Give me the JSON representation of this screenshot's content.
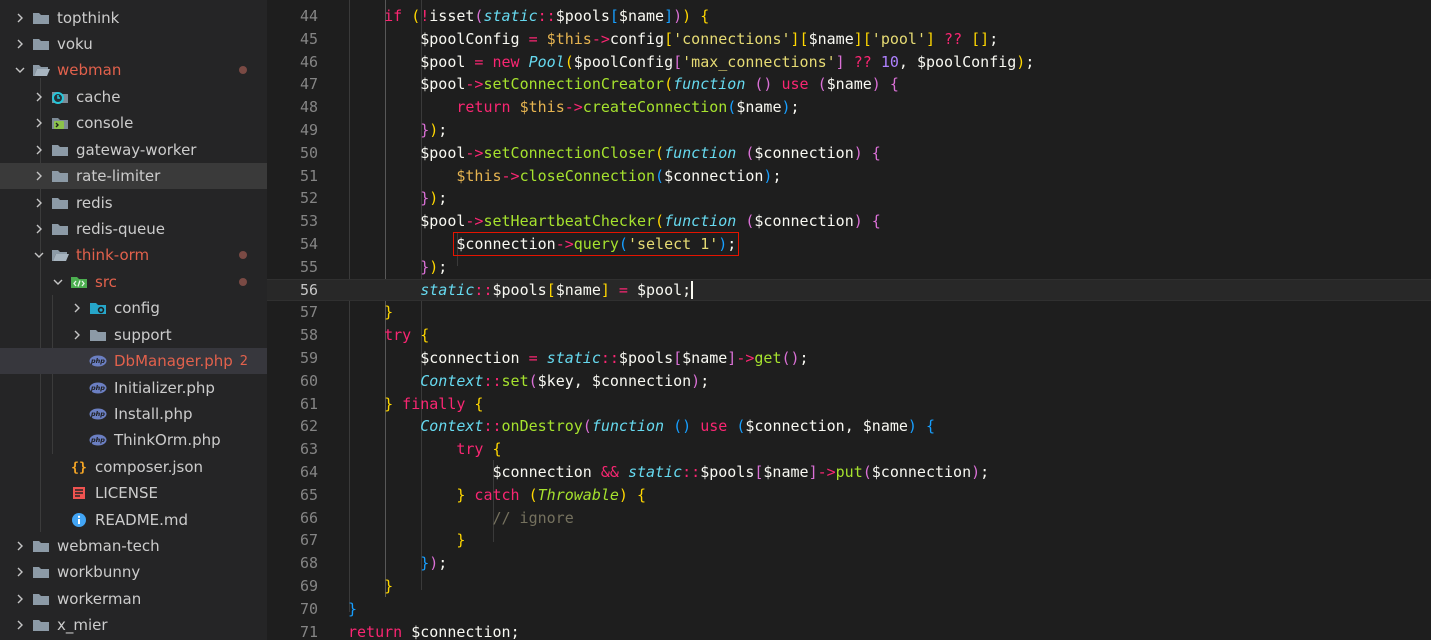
{
  "explorer": {
    "items": [
      {
        "label": "topthink",
        "icon": "folder-icon",
        "kind": "folder",
        "state": "collapsed"
      },
      {
        "label": "voku",
        "icon": "folder-icon",
        "kind": "folder",
        "state": "collapsed"
      },
      {
        "label": "webman",
        "icon": "folder-open-icon",
        "kind": "folder",
        "state": "expanded",
        "modified": true
      },
      {
        "label": "cache",
        "icon": "cache-folder-icon",
        "kind": "folder",
        "state": "collapsed"
      },
      {
        "label": "console",
        "icon": "console-folder-icon",
        "kind": "folder",
        "state": "collapsed"
      },
      {
        "label": "gateway-worker",
        "icon": "folder-icon",
        "kind": "folder",
        "state": "collapsed"
      },
      {
        "label": "rate-limiter",
        "icon": "folder-icon",
        "kind": "folder",
        "state": "collapsed"
      },
      {
        "label": "redis",
        "icon": "folder-icon",
        "kind": "folder",
        "state": "collapsed"
      },
      {
        "label": "redis-queue",
        "icon": "folder-icon",
        "kind": "folder",
        "state": "collapsed"
      },
      {
        "label": "think-orm",
        "icon": "folder-open-icon",
        "kind": "folder",
        "state": "expanded",
        "modified": true
      },
      {
        "label": "src",
        "icon": "src-folder-icon",
        "kind": "folder",
        "state": "expanded",
        "modified": true
      },
      {
        "label": "config",
        "icon": "config-folder-icon",
        "kind": "folder",
        "state": "collapsed"
      },
      {
        "label": "support",
        "icon": "folder-icon",
        "kind": "folder",
        "state": "collapsed"
      },
      {
        "label": "DbManager.php",
        "icon": "php-file-icon",
        "kind": "file",
        "modified": true,
        "badge": "2",
        "selected": true
      },
      {
        "label": "Initializer.php",
        "icon": "php-file-icon",
        "kind": "file"
      },
      {
        "label": "Install.php",
        "icon": "php-file-icon",
        "kind": "file"
      },
      {
        "label": "ThinkOrm.php",
        "icon": "php-file-icon",
        "kind": "file"
      },
      {
        "label": "composer.json",
        "icon": "json-file-icon",
        "kind": "file"
      },
      {
        "label": "LICENSE",
        "icon": "license-file-icon",
        "kind": "file"
      },
      {
        "label": "README.md",
        "icon": "info-file-icon",
        "kind": "file"
      },
      {
        "label": "webman-tech",
        "icon": "folder-icon",
        "kind": "folder",
        "state": "collapsed"
      },
      {
        "label": "workbunny",
        "icon": "folder-icon",
        "kind": "folder",
        "state": "collapsed"
      },
      {
        "label": "workerman",
        "icon": "folder-icon",
        "kind": "folder",
        "state": "collapsed"
      },
      {
        "label": "x_mier",
        "icon": "folder-icon",
        "kind": "folder",
        "state": "collapsed"
      }
    ]
  },
  "editor": {
    "current_line": 56,
    "lines": [
      {
        "n": "44",
        "indent": 2,
        "tokens": [
          [
            "k-kw",
            "if "
          ],
          [
            "k-p1",
            "("
          ],
          [
            "k-op",
            "!"
          ],
          [
            "k-plain",
            "isset"
          ],
          [
            "k-p2",
            "("
          ],
          [
            "k-cls",
            "static"
          ],
          [
            "k-op",
            "::"
          ],
          [
            "k-var",
            "$pools"
          ],
          [
            "k-p3",
            "["
          ],
          [
            "k-var",
            "$name"
          ],
          [
            "k-p3",
            "]"
          ],
          [
            "k-p2",
            ")"
          ],
          [
            "k-p1",
            ")"
          ],
          [
            "k-plain",
            " "
          ],
          [
            "k-p1",
            "{"
          ]
        ]
      },
      {
        "n": "45",
        "indent": 3,
        "tokens": [
          [
            "k-var",
            "$poolConfig "
          ],
          [
            "k-op",
            "="
          ],
          [
            "k-plain",
            " "
          ],
          [
            "k-this",
            "$this"
          ],
          [
            "k-op",
            "->"
          ],
          [
            "k-var",
            "config"
          ],
          [
            "k-p1",
            "["
          ],
          [
            "k-str",
            "'connections'"
          ],
          [
            "k-p1",
            "]"
          ],
          [
            "k-p1",
            "["
          ],
          [
            "k-var",
            "$name"
          ],
          [
            "k-p1",
            "]"
          ],
          [
            "k-p1",
            "["
          ],
          [
            "k-str",
            "'pool'"
          ],
          [
            "k-p1",
            "]"
          ],
          [
            "k-plain",
            " "
          ],
          [
            "k-op",
            "??"
          ],
          [
            "k-plain",
            " "
          ],
          [
            "k-p1",
            "[]"
          ],
          [
            "k-plain",
            ";"
          ]
        ]
      },
      {
        "n": "46",
        "indent": 3,
        "tokens": [
          [
            "k-var",
            "$pool "
          ],
          [
            "k-op",
            "="
          ],
          [
            "k-plain",
            " "
          ],
          [
            "k-kw",
            "new "
          ],
          [
            "k-cls",
            "Pool"
          ],
          [
            "k-p1",
            "("
          ],
          [
            "k-var",
            "$poolConfig"
          ],
          [
            "k-p2",
            "["
          ],
          [
            "k-str",
            "'max_connections'"
          ],
          [
            "k-p2",
            "]"
          ],
          [
            "k-plain",
            " "
          ],
          [
            "k-op",
            "??"
          ],
          [
            "k-plain",
            " "
          ],
          [
            "k-num",
            "10"
          ],
          [
            "k-plain",
            ", "
          ],
          [
            "k-var",
            "$poolConfig"
          ],
          [
            "k-p1",
            ")"
          ],
          [
            "k-plain",
            ";"
          ]
        ]
      },
      {
        "n": "47",
        "indent": 3,
        "tokens": [
          [
            "k-var",
            "$pool"
          ],
          [
            "k-op",
            "->"
          ],
          [
            "k-fn",
            "setConnectionCreator"
          ],
          [
            "k-p1",
            "("
          ],
          [
            "k-cls",
            "function"
          ],
          [
            "k-plain",
            " "
          ],
          [
            "k-p2",
            "()"
          ],
          [
            "k-plain",
            " "
          ],
          [
            "k-kw",
            "use"
          ],
          [
            "k-plain",
            " "
          ],
          [
            "k-p2",
            "("
          ],
          [
            "k-var",
            "$name"
          ],
          [
            "k-p2",
            ")"
          ],
          [
            "k-plain",
            " "
          ],
          [
            "k-p2",
            "{"
          ]
        ]
      },
      {
        "n": "48",
        "indent": 4,
        "tokens": [
          [
            "k-kw",
            "return "
          ],
          [
            "k-this",
            "$this"
          ],
          [
            "k-op",
            "->"
          ],
          [
            "k-fn",
            "createConnection"
          ],
          [
            "k-p3",
            "("
          ],
          [
            "k-var",
            "$name"
          ],
          [
            "k-p3",
            ")"
          ],
          [
            "k-plain",
            ";"
          ]
        ]
      },
      {
        "n": "49",
        "indent": 3,
        "tokens": [
          [
            "k-p2",
            "}"
          ],
          [
            "k-p1",
            ")"
          ],
          [
            "k-plain",
            ";"
          ]
        ]
      },
      {
        "n": "50",
        "indent": 3,
        "tokens": [
          [
            "k-var",
            "$pool"
          ],
          [
            "k-op",
            "->"
          ],
          [
            "k-fn",
            "setConnectionCloser"
          ],
          [
            "k-p1",
            "("
          ],
          [
            "k-cls",
            "function"
          ],
          [
            "k-plain",
            " "
          ],
          [
            "k-p2",
            "("
          ],
          [
            "k-var",
            "$connection"
          ],
          [
            "k-p2",
            ")"
          ],
          [
            "k-plain",
            " "
          ],
          [
            "k-p2",
            "{"
          ]
        ]
      },
      {
        "n": "51",
        "indent": 4,
        "tokens": [
          [
            "k-this",
            "$this"
          ],
          [
            "k-op",
            "->"
          ],
          [
            "k-fn",
            "closeConnection"
          ],
          [
            "k-p3",
            "("
          ],
          [
            "k-var",
            "$connection"
          ],
          [
            "k-p3",
            ")"
          ],
          [
            "k-plain",
            ";"
          ]
        ]
      },
      {
        "n": "52",
        "indent": 3,
        "tokens": [
          [
            "k-p2",
            "}"
          ],
          [
            "k-p1",
            ")"
          ],
          [
            "k-plain",
            ";"
          ]
        ]
      },
      {
        "n": "53",
        "indent": 3,
        "tokens": [
          [
            "k-var",
            "$pool"
          ],
          [
            "k-op",
            "->"
          ],
          [
            "k-fn",
            "setHeartbeatChecker"
          ],
          [
            "k-p1",
            "("
          ],
          [
            "k-cls",
            "function"
          ],
          [
            "k-plain",
            " "
          ],
          [
            "k-p2",
            "("
          ],
          [
            "k-var",
            "$connection"
          ],
          [
            "k-p2",
            ")"
          ],
          [
            "k-plain",
            " "
          ],
          [
            "k-p2",
            "{"
          ]
        ]
      },
      {
        "n": "54",
        "indent": 4,
        "box": true,
        "tokens": [
          [
            "k-var",
            "$connection"
          ],
          [
            "k-op",
            "->"
          ],
          [
            "k-fn",
            "query"
          ],
          [
            "k-p3",
            "("
          ],
          [
            "k-str",
            "'select 1'"
          ],
          [
            "k-p3",
            ")"
          ],
          [
            "k-plain",
            ";"
          ]
        ]
      },
      {
        "n": "55",
        "indent": 3,
        "tokens": [
          [
            "k-p2",
            "}"
          ],
          [
            "k-p1",
            ")"
          ],
          [
            "k-plain",
            ";"
          ]
        ]
      },
      {
        "n": "56",
        "indent": 3,
        "cursor": true,
        "tokens": [
          [
            "k-cls",
            "static"
          ],
          [
            "k-op",
            "::"
          ],
          [
            "k-var",
            "$pools"
          ],
          [
            "k-p1",
            "["
          ],
          [
            "k-var",
            "$name"
          ],
          [
            "k-p1",
            "]"
          ],
          [
            "k-plain",
            " "
          ],
          [
            "k-op",
            "="
          ],
          [
            "k-plain",
            " "
          ],
          [
            "k-var",
            "$pool"
          ],
          [
            "k-plain",
            ";"
          ]
        ]
      },
      {
        "n": "57",
        "indent": 2,
        "tokens": [
          [
            "k-p1",
            "}"
          ]
        ]
      },
      {
        "n": "58",
        "indent": 2,
        "tokens": [
          [
            "k-kw",
            "try "
          ],
          [
            "k-p1",
            "{"
          ]
        ]
      },
      {
        "n": "59",
        "indent": 3,
        "tokens": [
          [
            "k-var",
            "$connection "
          ],
          [
            "k-op",
            "="
          ],
          [
            "k-plain",
            " "
          ],
          [
            "k-cls",
            "static"
          ],
          [
            "k-op",
            "::"
          ],
          [
            "k-var",
            "$pools"
          ],
          [
            "k-p2",
            "["
          ],
          [
            "k-var",
            "$name"
          ],
          [
            "k-p2",
            "]"
          ],
          [
            "k-op",
            "->"
          ],
          [
            "k-fn",
            "get"
          ],
          [
            "k-p2",
            "()"
          ],
          [
            "k-plain",
            ";"
          ]
        ]
      },
      {
        "n": "60",
        "indent": 3,
        "tokens": [
          [
            "k-cls",
            "Context"
          ],
          [
            "k-op",
            "::"
          ],
          [
            "k-fn",
            "set"
          ],
          [
            "k-p2",
            "("
          ],
          [
            "k-var",
            "$key"
          ],
          [
            "k-plain",
            ", "
          ],
          [
            "k-var",
            "$connection"
          ],
          [
            "k-p2",
            ")"
          ],
          [
            "k-plain",
            ";"
          ]
        ]
      },
      {
        "n": "61",
        "indent": 2,
        "tokens": [
          [
            "k-p1",
            "} "
          ],
          [
            "k-kw",
            "finally "
          ],
          [
            "k-p1",
            "{"
          ]
        ]
      },
      {
        "n": "62",
        "indent": 3,
        "tokens": [
          [
            "k-cls",
            "Context"
          ],
          [
            "k-op",
            "::"
          ],
          [
            "k-fn",
            "onDestroy"
          ],
          [
            "k-p2",
            "("
          ],
          [
            "k-cls",
            "function"
          ],
          [
            "k-plain",
            " "
          ],
          [
            "k-p3",
            "()"
          ],
          [
            "k-plain",
            " "
          ],
          [
            "k-kw",
            "use"
          ],
          [
            "k-plain",
            " "
          ],
          [
            "k-p3",
            "("
          ],
          [
            "k-var",
            "$connection"
          ],
          [
            "k-plain",
            ", "
          ],
          [
            "k-var",
            "$name"
          ],
          [
            "k-p3",
            ")"
          ],
          [
            "k-plain",
            " "
          ],
          [
            "k-p3",
            "{"
          ]
        ]
      },
      {
        "n": "63",
        "indent": 4,
        "tokens": [
          [
            "k-kw",
            "try "
          ],
          [
            "k-p1",
            "{"
          ]
        ]
      },
      {
        "n": "64",
        "indent": 5,
        "tokens": [
          [
            "k-var",
            "$connection "
          ],
          [
            "k-op",
            "&&"
          ],
          [
            "k-plain",
            " "
          ],
          [
            "k-cls",
            "static"
          ],
          [
            "k-op",
            "::"
          ],
          [
            "k-var",
            "$pools"
          ],
          [
            "k-p2",
            "["
          ],
          [
            "k-var",
            "$name"
          ],
          [
            "k-p2",
            "]"
          ],
          [
            "k-op",
            "->"
          ],
          [
            "k-fn",
            "put"
          ],
          [
            "k-p2",
            "("
          ],
          [
            "k-var",
            "$connection"
          ],
          [
            "k-p2",
            ")"
          ],
          [
            "k-plain",
            ";"
          ]
        ]
      },
      {
        "n": "65",
        "indent": 4,
        "tokens": [
          [
            "k-p1",
            "} "
          ],
          [
            "k-kw",
            "catch "
          ],
          [
            "k-p1",
            "("
          ],
          [
            "k-cls2",
            "Throwable"
          ],
          [
            "k-p1",
            ")"
          ],
          [
            "k-plain",
            " "
          ],
          [
            "k-p1",
            "{"
          ]
        ]
      },
      {
        "n": "66",
        "indent": 5,
        "tokens": [
          [
            "k-cm",
            "// ignore"
          ]
        ]
      },
      {
        "n": "67",
        "indent": 4,
        "tokens": [
          [
            "k-p1",
            "}"
          ]
        ]
      },
      {
        "n": "68",
        "indent": 3,
        "tokens": [
          [
            "k-p3",
            "}"
          ],
          [
            "k-p2",
            ")"
          ],
          [
            "k-plain",
            ";"
          ]
        ]
      },
      {
        "n": "69",
        "indent": 2,
        "tokens": [
          [
            "k-p1",
            "}"
          ]
        ]
      },
      {
        "n": "70",
        "indent": 1,
        "tokens": [
          [
            "k-p3",
            "}"
          ]
        ]
      },
      {
        "n": "71",
        "indent": 1,
        "tokens": [
          [
            "k-kw",
            "return "
          ],
          [
            "k-var",
            "$connection"
          ],
          [
            "k-plain",
            ";"
          ]
        ]
      }
    ]
  },
  "colors": {
    "sidebar_bg": "#252526",
    "editor_bg": "#1e1e1e",
    "modified_text": "#e2614c",
    "highlight_box": "#e51400"
  }
}
